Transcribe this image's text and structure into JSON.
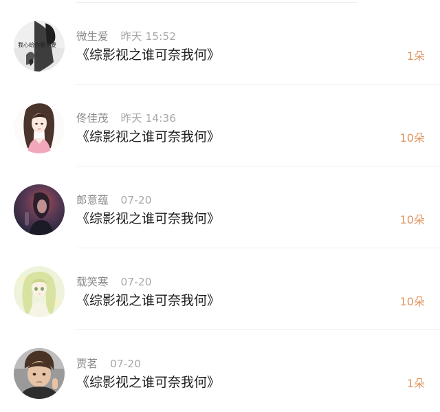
{
  "records": [
    {
      "name": "微生爱",
      "time": "昨天 15:52",
      "title": "《综影视之谁可奈我何》",
      "count": "1朵",
      "avatar_icon": "avatar-bw-couple-photo",
      "avatar_text": "我心给你要不要"
    },
    {
      "name": "佟佳茂",
      "time": "昨天 14:36",
      "title": "《综影视之谁可奈我何》",
      "count": "10朵",
      "avatar_icon": "avatar-anime-girl-pink"
    },
    {
      "name": "郎意蕴",
      "time": "07-20",
      "title": "《综影视之谁可奈我何》",
      "count": "10朵",
      "avatar_icon": "avatar-dark-portrait"
    },
    {
      "name": "载笑寒",
      "time": "07-20",
      "title": "《综影视之谁可奈我何》",
      "count": "10朵",
      "avatar_icon": "avatar-anime-girl-green"
    },
    {
      "name": "贾茗",
      "time": "07-20",
      "title": "《综影视之谁可奈我何》",
      "count": "1朵",
      "avatar_icon": "avatar-child-photo"
    }
  ],
  "colors": {
    "count": "#e0955f",
    "name": "#8a8a8a",
    "title": "#1e1e1e",
    "divider": "#efefef"
  }
}
